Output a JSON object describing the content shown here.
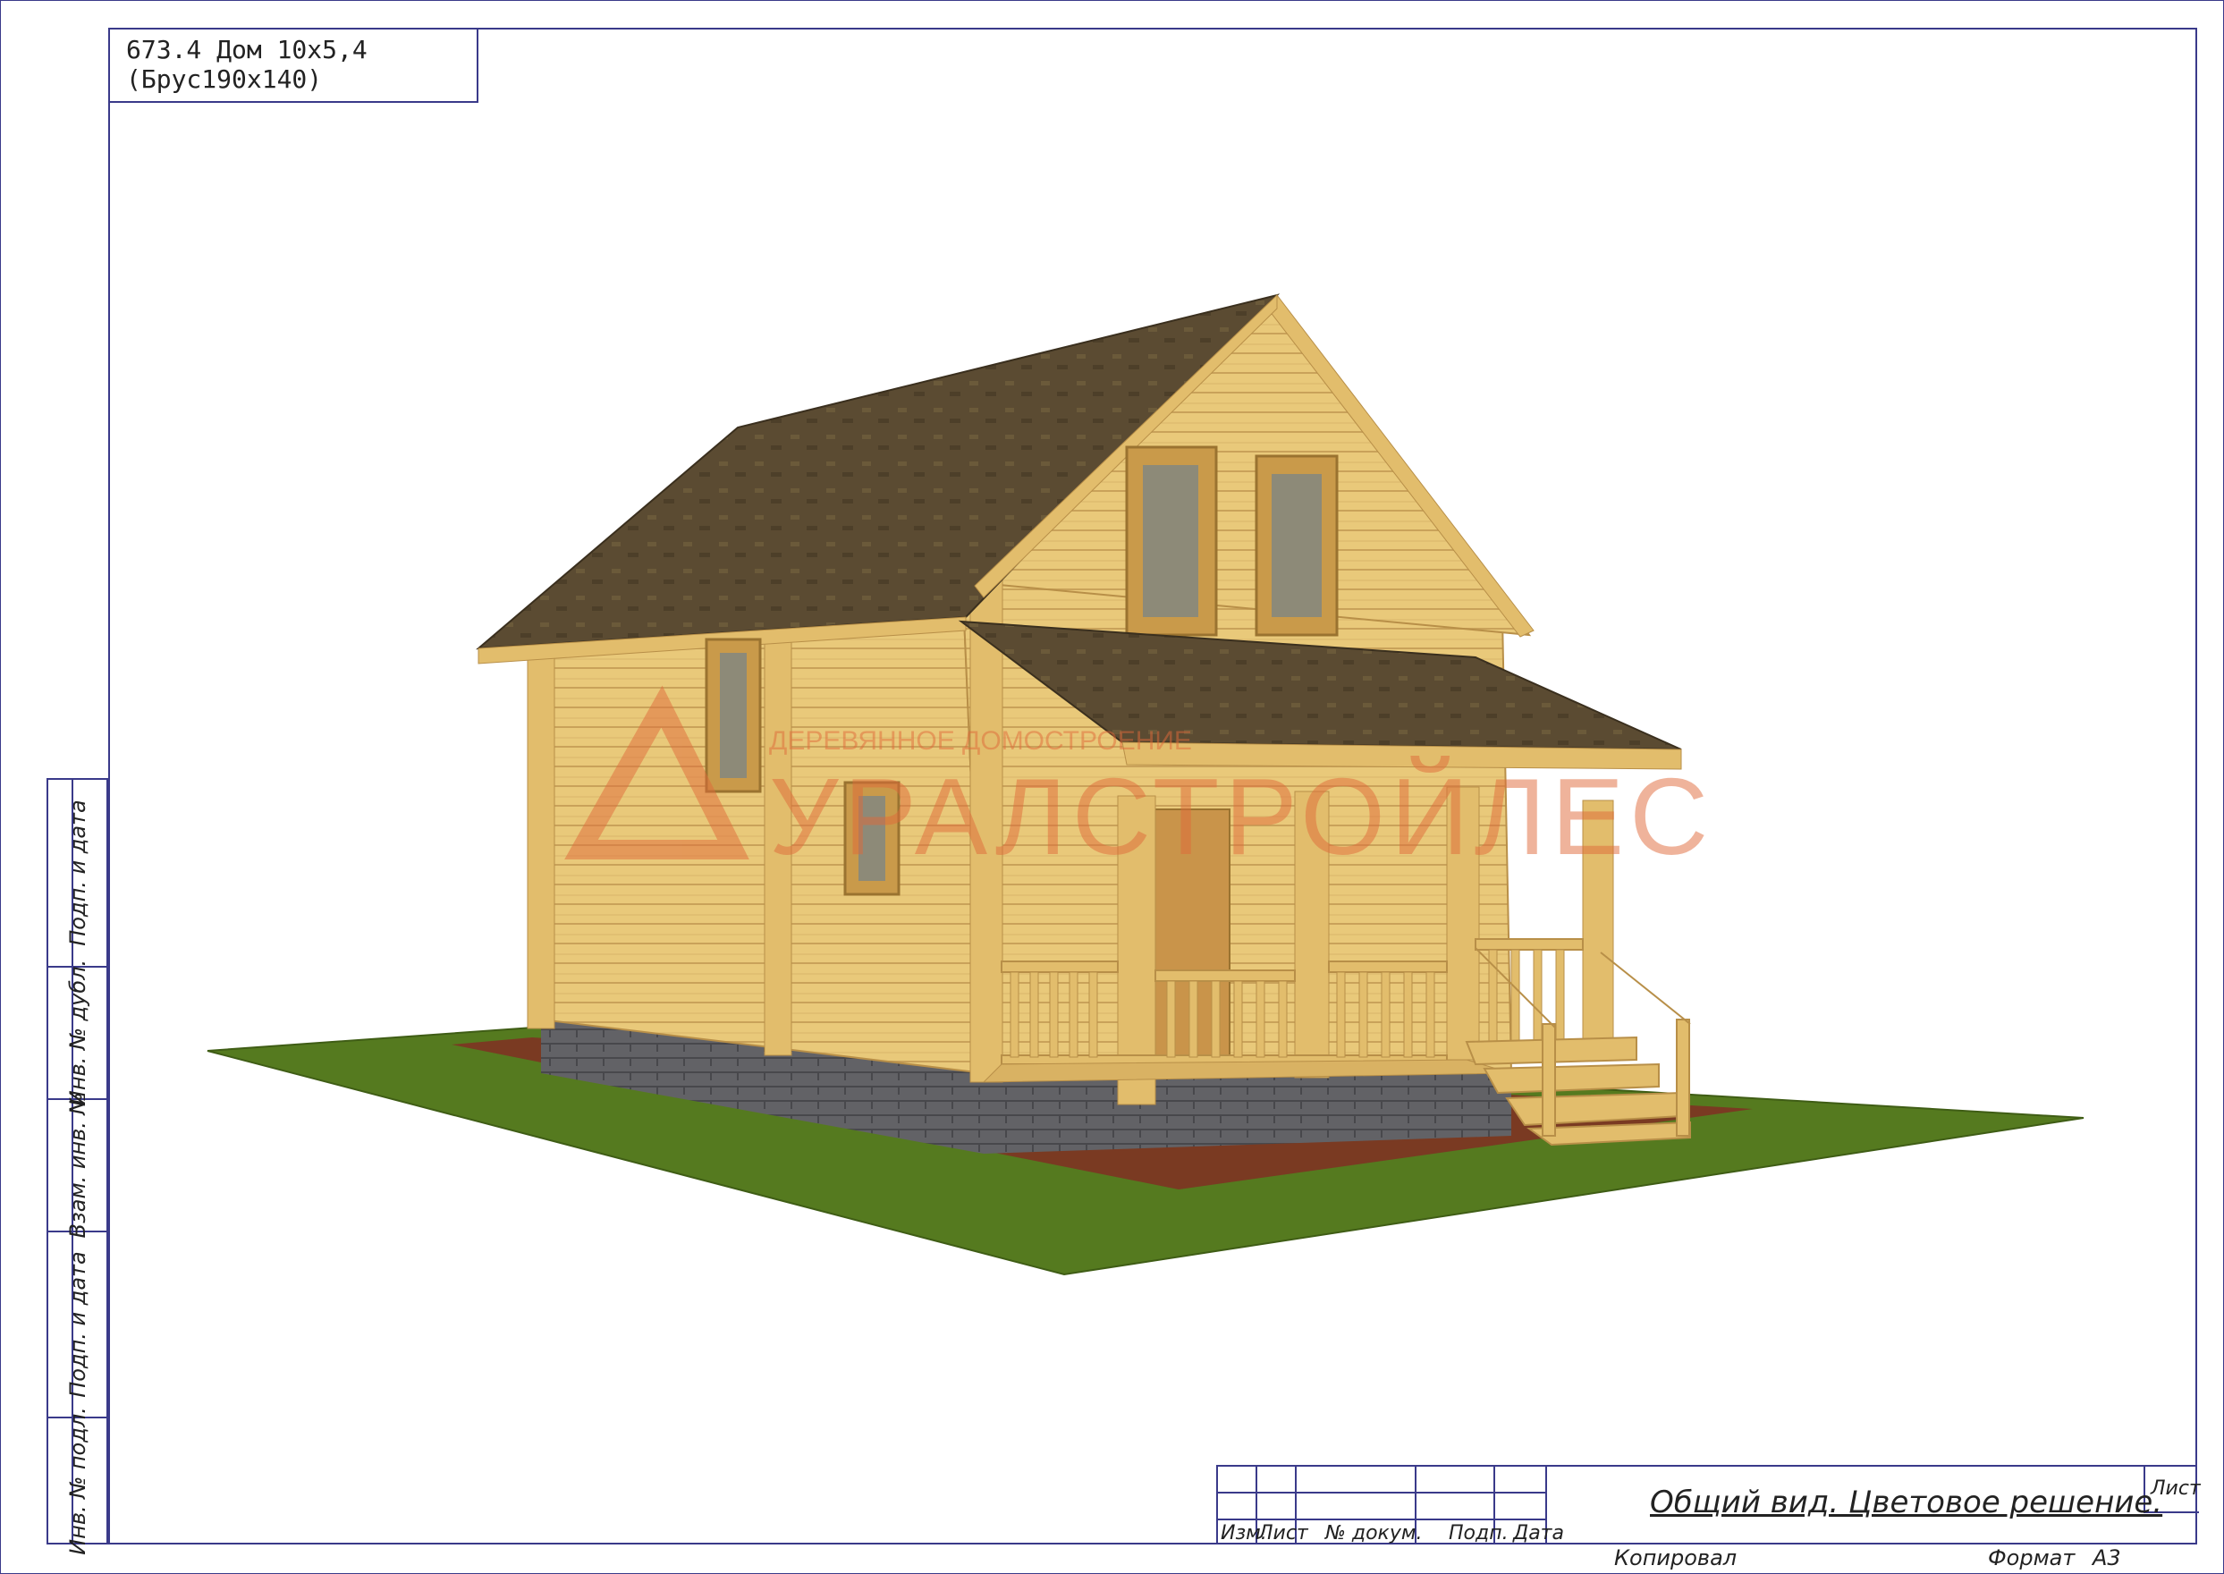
{
  "header": {
    "project_title": "673.4 Дом 10х5,4 (Брус190х140)"
  },
  "watermark": {
    "brand": "УРАЛСТРОЙЛЕС",
    "tagline": "ДЕРЕВЯННОЕ ДОМОСТРОЕНИЕ"
  },
  "side_stamp": {
    "cells": [
      "Подп. и дата",
      "Инв. № дубл.",
      "Взам. инв. №",
      "Подп. и дата",
      "Инв. № подл."
    ]
  },
  "title_block": {
    "columns": [
      "Изм.",
      "Лист",
      "№ докум.",
      "Подп.",
      "Дата"
    ],
    "sheet_title": "Общий вид. Цветовое решение.",
    "sheet_label": "Лист",
    "copied_label": "Копировал",
    "format_label": "Формат",
    "format_value": "А3"
  },
  "colors": {
    "frame": "#3a3a8a",
    "roof": "#5a4a30",
    "timber": "#e8c878",
    "grass": "#557a1f",
    "foundation": "#5e5e5e",
    "watermark": "#e06a3a"
  }
}
